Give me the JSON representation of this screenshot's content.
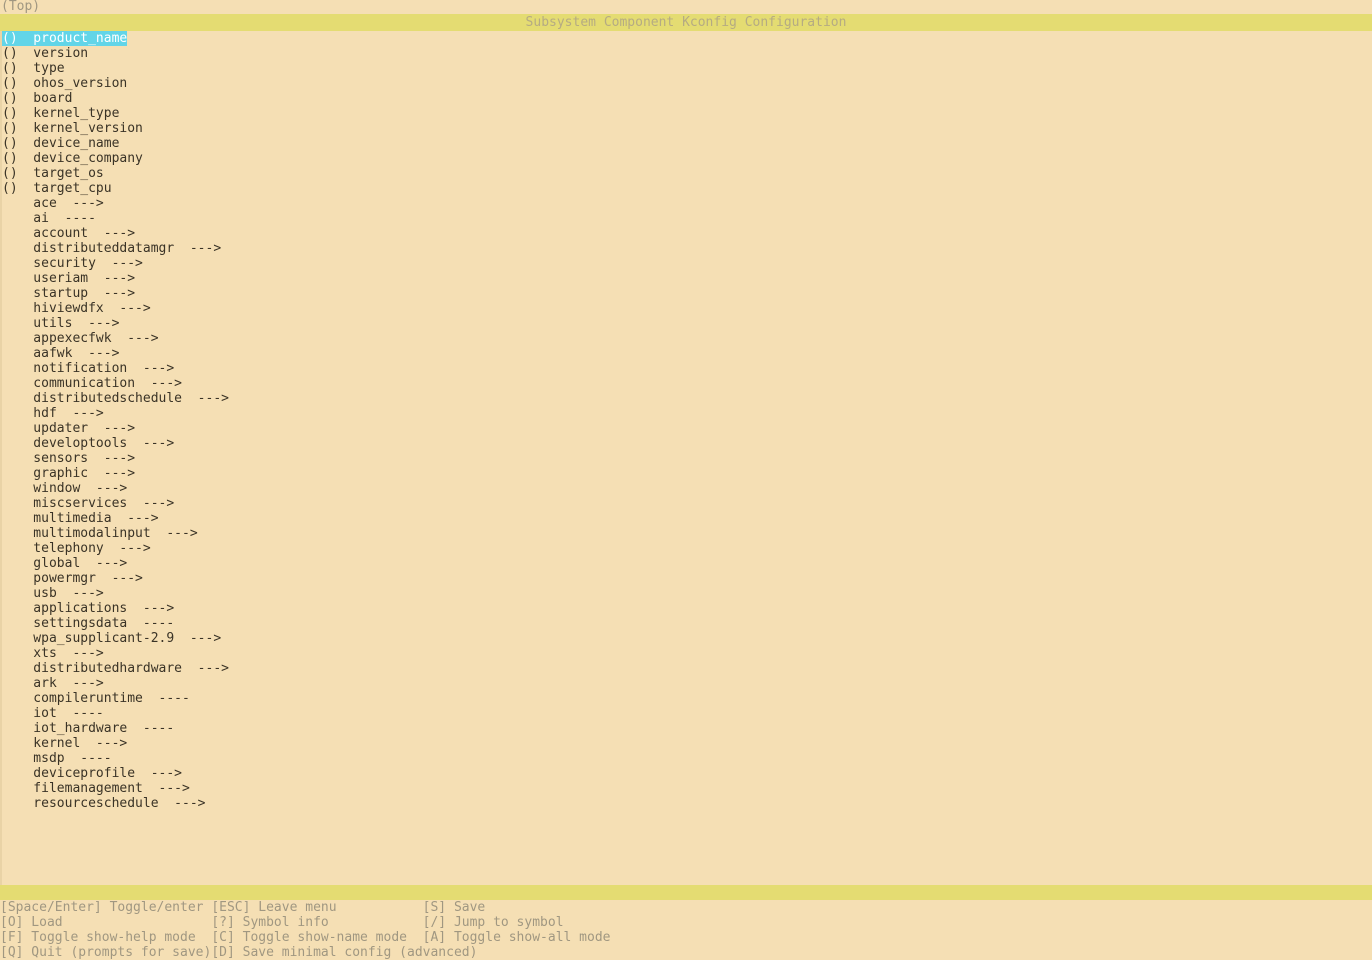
{
  "window": {
    "path_line": "(Top)",
    "title": "Subsystem Component Kconfig Configuration"
  },
  "menu": {
    "selected_index": 0,
    "items": [
      {
        "prefix": "()",
        "label": "product_name",
        "suffix": "",
        "selected": true
      },
      {
        "prefix": "()",
        "label": "version",
        "suffix": "",
        "selected": false
      },
      {
        "prefix": "()",
        "label": "type",
        "suffix": "",
        "selected": false
      },
      {
        "prefix": "()",
        "label": "ohos_version",
        "suffix": "",
        "selected": false
      },
      {
        "prefix": "()",
        "label": "board",
        "suffix": "",
        "selected": false
      },
      {
        "prefix": "()",
        "label": "kernel_type",
        "suffix": "",
        "selected": false
      },
      {
        "prefix": "()",
        "label": "kernel_version",
        "suffix": "",
        "selected": false
      },
      {
        "prefix": "()",
        "label": "device_name",
        "suffix": "",
        "selected": false
      },
      {
        "prefix": "()",
        "label": "device_company",
        "suffix": "",
        "selected": false
      },
      {
        "prefix": "()",
        "label": "target_os",
        "suffix": "",
        "selected": false
      },
      {
        "prefix": "()",
        "label": "target_cpu",
        "suffix": "",
        "selected": false
      },
      {
        "prefix": "  ",
        "label": "ace",
        "suffix": "--->",
        "selected": false
      },
      {
        "prefix": "  ",
        "label": "ai",
        "suffix": "----",
        "selected": false
      },
      {
        "prefix": "  ",
        "label": "account",
        "suffix": "--->",
        "selected": false
      },
      {
        "prefix": "  ",
        "label": "distributeddatamgr",
        "suffix": "--->",
        "selected": false
      },
      {
        "prefix": "  ",
        "label": "security",
        "suffix": "--->",
        "selected": false
      },
      {
        "prefix": "  ",
        "label": "useriam",
        "suffix": "--->",
        "selected": false
      },
      {
        "prefix": "  ",
        "label": "startup",
        "suffix": "--->",
        "selected": false
      },
      {
        "prefix": "  ",
        "label": "hiviewdfx",
        "suffix": "--->",
        "selected": false
      },
      {
        "prefix": "  ",
        "label": "utils",
        "suffix": "--->",
        "selected": false
      },
      {
        "prefix": "  ",
        "label": "appexecfwk",
        "suffix": "--->",
        "selected": false
      },
      {
        "prefix": "  ",
        "label": "aafwk",
        "suffix": "--->",
        "selected": false
      },
      {
        "prefix": "  ",
        "label": "notification",
        "suffix": "--->",
        "selected": false
      },
      {
        "prefix": "  ",
        "label": "communication",
        "suffix": "--->",
        "selected": false
      },
      {
        "prefix": "  ",
        "label": "distributedschedule",
        "suffix": "--->",
        "selected": false
      },
      {
        "prefix": "  ",
        "label": "hdf",
        "suffix": "--->",
        "selected": false
      },
      {
        "prefix": "  ",
        "label": "updater",
        "suffix": "--->",
        "selected": false
      },
      {
        "prefix": "  ",
        "label": "developtools",
        "suffix": "--->",
        "selected": false
      },
      {
        "prefix": "  ",
        "label": "sensors",
        "suffix": "--->",
        "selected": false
      },
      {
        "prefix": "  ",
        "label": "graphic",
        "suffix": "--->",
        "selected": false
      },
      {
        "prefix": "  ",
        "label": "window",
        "suffix": "--->",
        "selected": false
      },
      {
        "prefix": "  ",
        "label": "miscservices",
        "suffix": "--->",
        "selected": false
      },
      {
        "prefix": "  ",
        "label": "multimedia",
        "suffix": "--->",
        "selected": false
      },
      {
        "prefix": "  ",
        "label": "multimodalinput",
        "suffix": "--->",
        "selected": false
      },
      {
        "prefix": "  ",
        "label": "telephony",
        "suffix": "--->",
        "selected": false
      },
      {
        "prefix": "  ",
        "label": "global",
        "suffix": "--->",
        "selected": false
      },
      {
        "prefix": "  ",
        "label": "powermgr",
        "suffix": "--->",
        "selected": false
      },
      {
        "prefix": "  ",
        "label": "usb",
        "suffix": "--->",
        "selected": false
      },
      {
        "prefix": "  ",
        "label": "applications",
        "suffix": "--->",
        "selected": false
      },
      {
        "prefix": "  ",
        "label": "settingsdata",
        "suffix": "----",
        "selected": false
      },
      {
        "prefix": "  ",
        "label": "wpa_supplicant-2.9",
        "suffix": "--->",
        "selected": false
      },
      {
        "prefix": "  ",
        "label": "xts",
        "suffix": "--->",
        "selected": false
      },
      {
        "prefix": "  ",
        "label": "distributedhardware",
        "suffix": "--->",
        "selected": false
      },
      {
        "prefix": "  ",
        "label": "ark",
        "suffix": "--->",
        "selected": false
      },
      {
        "prefix": "  ",
        "label": "compileruntime",
        "suffix": "----",
        "selected": false
      },
      {
        "prefix": "  ",
        "label": "iot",
        "suffix": "----",
        "selected": false
      },
      {
        "prefix": "  ",
        "label": "iot_hardware",
        "suffix": "----",
        "selected": false
      },
      {
        "prefix": "  ",
        "label": "kernel",
        "suffix": "--->",
        "selected": false
      },
      {
        "prefix": "  ",
        "label": "msdp",
        "suffix": "----",
        "selected": false
      },
      {
        "prefix": "  ",
        "label": "deviceprofile",
        "suffix": "--->",
        "selected": false
      },
      {
        "prefix": "  ",
        "label": "filemanagement",
        "suffix": "--->",
        "selected": false
      },
      {
        "prefix": "  ",
        "label": "resourceschedule",
        "suffix": "--->",
        "selected": false
      }
    ]
  },
  "help": {
    "rows": [
      [
        {
          "key": "[Space/Enter]",
          "action": "Toggle/enter"
        },
        {
          "key": "[ESC]",
          "action": "Leave menu"
        },
        {
          "key": "[S]",
          "action": "Save"
        }
      ],
      [
        {
          "key": "[O]",
          "action": "Load"
        },
        {
          "key": "[?]",
          "action": "Symbol info"
        },
        {
          "key": "[/]",
          "action": "Jump to symbol"
        }
      ],
      [
        {
          "key": "[F]",
          "action": "Toggle show-help mode"
        },
        {
          "key": "[C]",
          "action": "Toggle show-name mode"
        },
        {
          "key": "[A]",
          "action": "Toggle show-all mode"
        }
      ],
      [
        {
          "key": "[Q]",
          "action": "Quit (prompts for save)"
        },
        {
          "key": "[D]",
          "action": "Save minimal config (advanced)"
        },
        {
          "key": "",
          "action": ""
        }
      ]
    ]
  },
  "colors": {
    "background": "#f5dfb4",
    "bar": "#e4dc72",
    "highlight": "#62d5e8",
    "highlight_text": "#ffffff",
    "text": "#3a3326",
    "dim_text": "#a09781",
    "title_text": "#b5ab83"
  }
}
